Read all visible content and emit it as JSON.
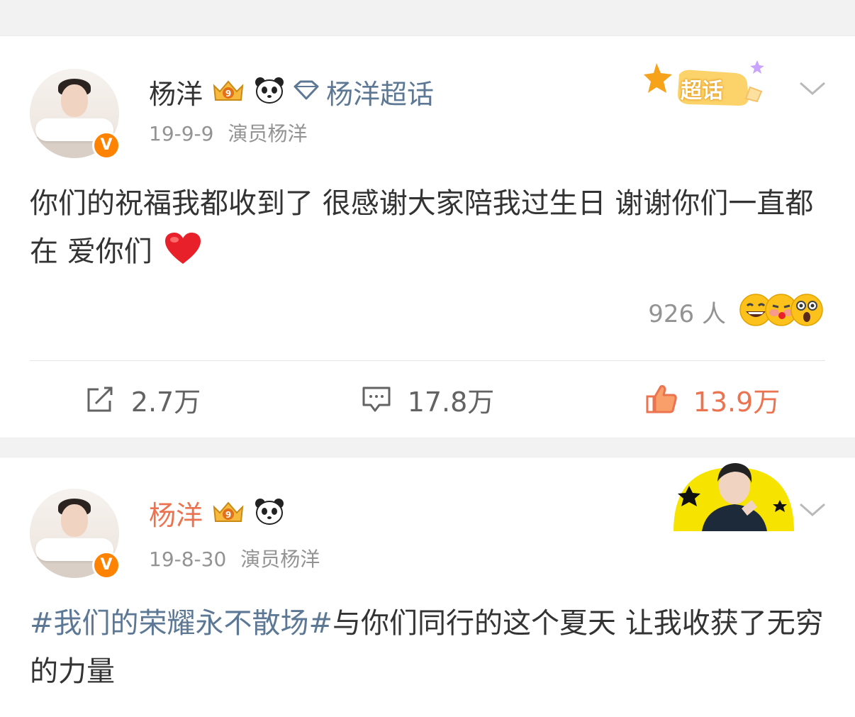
{
  "posts": [
    {
      "author": "杨洋",
      "super_topic": "杨洋超话",
      "super_topic_badge": "超话",
      "date": "19-9-9",
      "source": "演员杨洋",
      "text": "你们的祝福我都收到了 很感谢大家陪我过生日 谢谢你们一直都在 爱你们",
      "text_emoji": "heart",
      "reaction_count": "926 人",
      "actions": {
        "repost": "2.7万",
        "comment": "17.8万",
        "like": "13.9万"
      },
      "colors": {
        "like_active": "#eb7350",
        "link": "#5d7895"
      }
    },
    {
      "author": "杨洋",
      "date": "19-8-30",
      "source": "演员杨洋",
      "hashtag": "#我们的荣耀永不散场#",
      "text": "与你们同行的这个夏天 让我收获了无穷的力量",
      "colors": {
        "author_name": "#eb7350"
      }
    }
  ],
  "icons": {
    "verified": "v-badge",
    "member": "crown-icon",
    "panda": "panda-icon",
    "diamond": "diamond-icon",
    "menu": "chevron-down-icon",
    "repost": "repost-icon",
    "comment": "comment-icon",
    "like": "thumbs-up-icon"
  }
}
